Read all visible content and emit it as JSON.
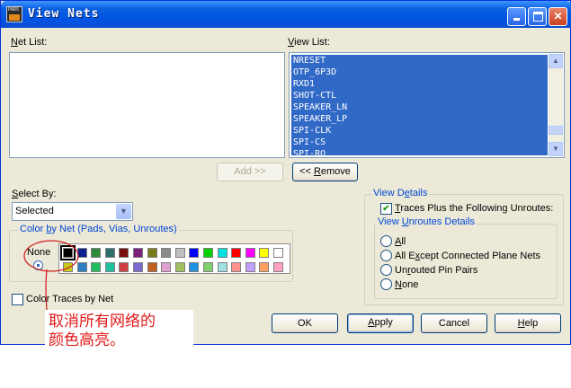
{
  "window": {
    "title": "View Nets",
    "icon": "pads-logic-icon",
    "app_icon_text": "PADS"
  },
  "title_buttons": {
    "minimize": "minimize-icon",
    "maximize": "maximize-icon",
    "close": "close-icon"
  },
  "net_list": {
    "label_pre": "",
    "label_key": "N",
    "label_post": "et List:",
    "items": []
  },
  "view_list": {
    "label_key": "V",
    "label_post": "iew List:",
    "items": [
      "NRESET",
      "OTP_6P3D",
      "RXD1",
      "SHOT-CTL",
      "SPEAKER_LN",
      "SPEAKER_LP",
      "SPI-CLK",
      "SPI-CS",
      "SPI-RQ"
    ]
  },
  "buttons": {
    "add": "Add >>",
    "remove_pre": "<< ",
    "remove_key": "R",
    "remove_post": "emove",
    "ok": "OK",
    "apply_key": "A",
    "apply_post": "pply",
    "cancel": "Cancel",
    "help_key": "H",
    "help_post": "elp"
  },
  "select_by": {
    "label_pre": "S",
    "label_post": "elect By:",
    "value": "Selected"
  },
  "color_group": {
    "title_pre": "Color ",
    "title_key": "b",
    "title_post": "y Net (Pads, Vias, Unroutes)",
    "none_label": "None",
    "row1": [
      "#000000",
      "#0a1f8f",
      "#2f8a3a",
      "#2f6f6f",
      "#7a1010",
      "#7a1f7a",
      "#7a7a1a",
      "#8c8c8c",
      "#c0c0c0",
      "#0000ff",
      "#00d000",
      "#00e0e0",
      "#ff0000",
      "#ff00ff",
      "#ffff00",
      "#ffffff"
    ],
    "row2": [
      "#c8c81e",
      "#2e7fbf",
      "#1fbf5f",
      "#1fbfa0",
      "#d04040",
      "#7a6ad0",
      "#c06020",
      "#e0a0d0",
      "#a0c060",
      "#2090e0",
      "#80d070",
      "#a0e0e0",
      "#ff9090",
      "#c0a0ff",
      "#ffa060",
      "#ffa0c0"
    ]
  },
  "color_traces": {
    "label": "Color Traces by Net",
    "checked": false
  },
  "view_details": {
    "title_pre": "View D",
    "title_key": "e",
    "title_post": "tails",
    "traces_label_key": "T",
    "traces_label_post": "races Plus the Following Unroutes:",
    "traces_checked": true,
    "unroutes_group": {
      "title_pre": "View ",
      "title_key": "U",
      "title_post": "nroutes Details",
      "options": [
        {
          "pre": "",
          "key": "A",
          "post": "ll"
        },
        {
          "pre": "All E",
          "key": "x",
          "post": "cept Connected Plane Nets"
        },
        {
          "pre": "Un",
          "key": "r",
          "post": "outed Pin Pairs"
        },
        {
          "pre": "",
          "key": "N",
          "post": "one"
        }
      ]
    }
  },
  "annotation": {
    "line1": "取消所有网络的",
    "line2": "颜色高亮。",
    "color": "#e01a1a"
  }
}
